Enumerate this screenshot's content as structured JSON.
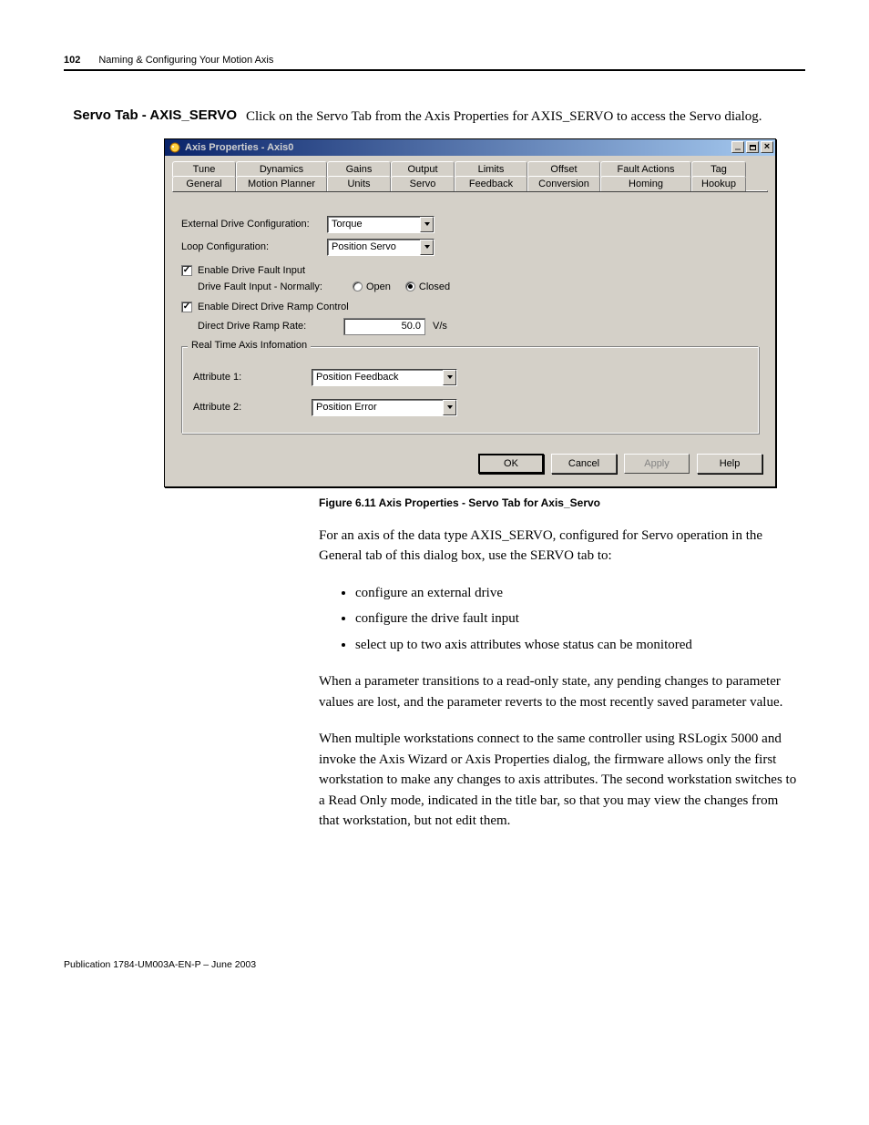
{
  "header": {
    "page_num": "102",
    "chapter": "Naming & Configuring Your Motion Axis"
  },
  "section": {
    "title": "Servo Tab - AXIS_SERVO",
    "intro": "Click on the Servo Tab from the Axis Properties for AXIS_SERVO to access the Servo dialog."
  },
  "dialog": {
    "title": "Axis Properties - Axis0",
    "tabs_back": [
      "Tune",
      "Dynamics",
      "Gains",
      "Output",
      "Limits",
      "Offset",
      "Fault Actions",
      "Tag"
    ],
    "tabs_front": [
      "General",
      "Motion Planner",
      "Units",
      "Servo",
      "Feedback",
      "Conversion",
      "Homing",
      "Hookup"
    ],
    "active_tab": "Servo",
    "ext_drive_label": "External Drive Configuration:",
    "ext_drive_value": "Torque",
    "loop_config_label": "Loop Configuration:",
    "loop_config_value": "Position Servo",
    "enable_drive_fault": "Enable Drive Fault Input",
    "drive_fault_input_label": "Drive Fault Input - Normally:",
    "radio_open": "Open",
    "radio_closed": "Closed",
    "enable_direct_ramp": "Enable Direct Drive Ramp Control",
    "ramp_rate_label": "Direct Drive Ramp Rate:",
    "ramp_rate_value": "50.0",
    "ramp_rate_unit": "V/s",
    "group_legend": "Real Time Axis Infomation",
    "attr1_label": "Attribute 1:",
    "attr1_value": "Position Feedback",
    "attr2_label": "Attribute 2:",
    "attr2_value": "Position Error",
    "ok": "OK",
    "cancel": "Cancel",
    "apply": "Apply",
    "help": "Help"
  },
  "caption": "Figure 6.11 Axis Properties - Servo Tab for Axis_Servo",
  "p1": "For an axis of the data type AXIS_SERVO, configured for Servo operation in the General tab of this dialog box, use the SERVO tab to:",
  "bullets": [
    "configure an external drive",
    "configure the drive fault input",
    "select up to two axis attributes whose status can be monitored"
  ],
  "p2": "When a parameter transitions to a read-only state, any pending changes to parameter values are lost, and the parameter reverts to the most recently saved parameter value.",
  "p3": "When multiple workstations connect to the same controller using RSLogix 5000 and invoke the Axis Wizard or Axis Properties dialog, the firmware allows only the first workstation to make any changes to axis attributes. The second workstation switches to a Read Only mode, indicated in the title bar, so that you may view the changes from that workstation, but not edit them.",
  "footer": "Publication 1784-UM003A-EN-P – June 2003"
}
